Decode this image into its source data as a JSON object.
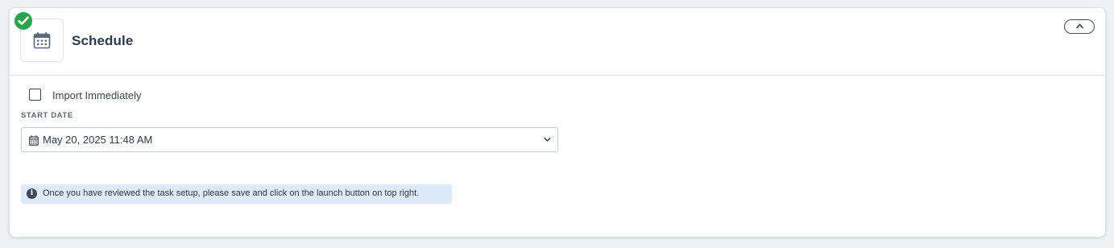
{
  "section": {
    "title": "Schedule",
    "status_icon": "check-circle-icon",
    "section_icon": "calendar-icon",
    "collapse_icon": "chevron-up-icon",
    "status_color": "#2ba24c"
  },
  "import_immediately": {
    "label": "Import Immediately",
    "checked": false
  },
  "start_date": {
    "label": "START DATE",
    "value": "May 20, 2025 11:48 AM",
    "icon": "calendar-icon",
    "dropdown_icon": "chevron-down-icon"
  },
  "info_banner": {
    "icon": "info-icon",
    "text": "Once you have reviewed the task setup, please save and click on the launch button on top right.",
    "background": "#dfeaf8"
  }
}
